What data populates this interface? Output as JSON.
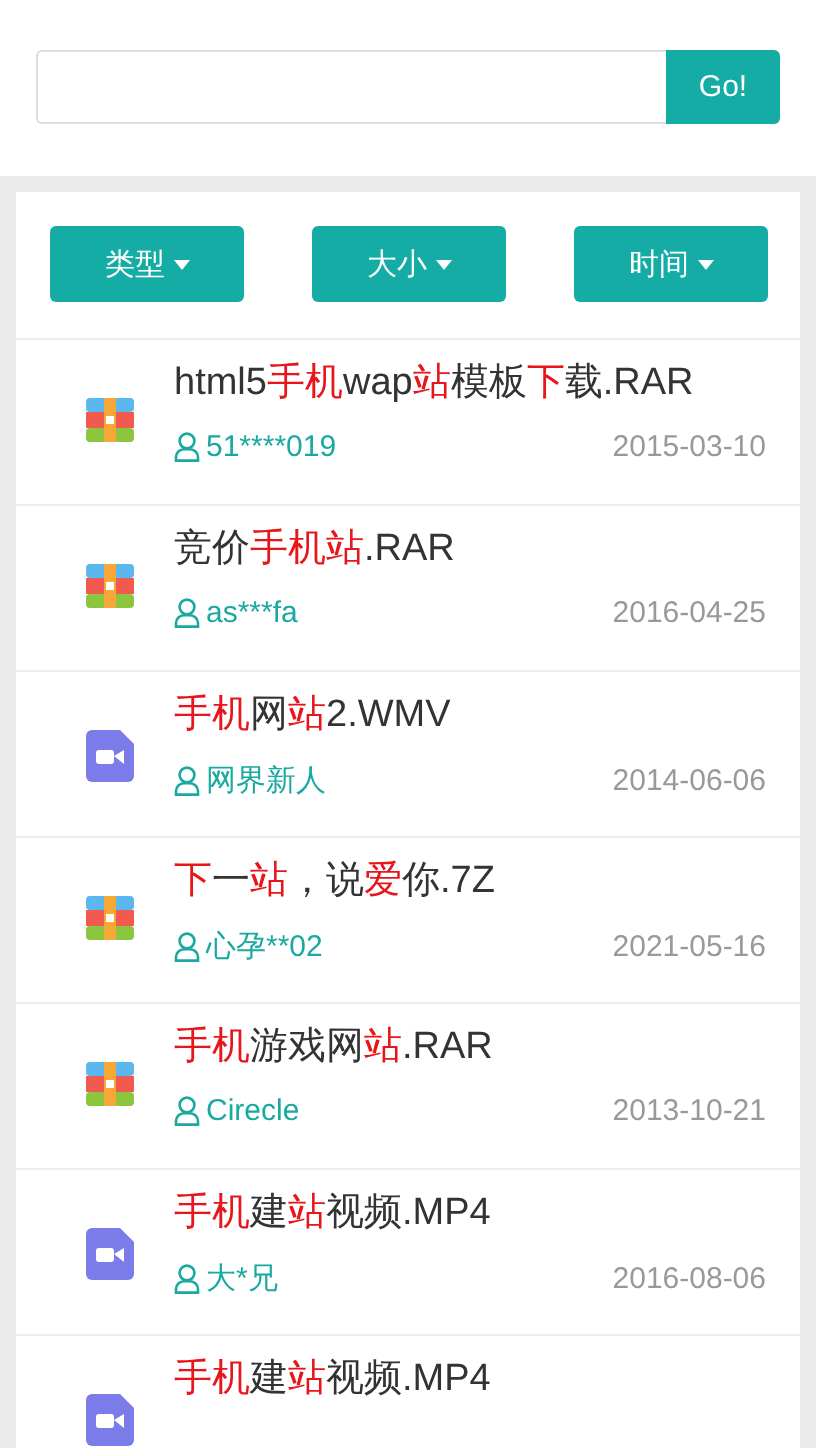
{
  "search": {
    "button": "Go!"
  },
  "filters": [
    {
      "label": "类型"
    },
    {
      "label": "大小"
    },
    {
      "label": "时间"
    }
  ],
  "files": [
    {
      "kind": "archive",
      "title": [
        {
          "text": "html5",
          "highlight": false
        },
        {
          "text": "手机",
          "highlight": true
        },
        {
          "text": "wap",
          "highlight": false
        },
        {
          "text": "站",
          "highlight": true
        },
        {
          "text": "模板",
          "highlight": false
        },
        {
          "text": "下",
          "highlight": true
        },
        {
          "text": "载.RAR",
          "highlight": false
        }
      ],
      "user": "51****019",
      "date": "2015-03-10"
    },
    {
      "kind": "archive",
      "title": [
        {
          "text": "竞价",
          "highlight": false
        },
        {
          "text": "手机站",
          "highlight": true
        },
        {
          "text": ".RAR",
          "highlight": false
        }
      ],
      "user": "as***fa",
      "date": "2016-04-25"
    },
    {
      "kind": "video",
      "title": [
        {
          "text": "手机",
          "highlight": true
        },
        {
          "text": "网",
          "highlight": false
        },
        {
          "text": "站",
          "highlight": true
        },
        {
          "text": "2.WMV",
          "highlight": false
        }
      ],
      "user": "网界新人",
      "date": "2014-06-06"
    },
    {
      "kind": "archive",
      "title": [
        {
          "text": "下",
          "highlight": true
        },
        {
          "text": "一",
          "highlight": false
        },
        {
          "text": "站",
          "highlight": true
        },
        {
          "text": "，说",
          "highlight": false
        },
        {
          "text": "爱",
          "highlight": true
        },
        {
          "text": "你.7Z",
          "highlight": false
        }
      ],
      "user": "心孕**02",
      "date": "2021-05-16"
    },
    {
      "kind": "archive",
      "title": [
        {
          "text": "手机",
          "highlight": true
        },
        {
          "text": "游戏网",
          "highlight": false
        },
        {
          "text": "站",
          "highlight": true
        },
        {
          "text": ".RAR",
          "highlight": false
        }
      ],
      "user": "Cirecle",
      "date": "2013-10-21"
    },
    {
      "kind": "video",
      "title": [
        {
          "text": "手机",
          "highlight": true
        },
        {
          "text": "建",
          "highlight": false
        },
        {
          "text": "站",
          "highlight": true
        },
        {
          "text": "视频.MP4",
          "highlight": false
        }
      ],
      "user": "大*兄",
      "date": "2016-08-06"
    },
    {
      "kind": "video",
      "title": [
        {
          "text": "手机",
          "highlight": true
        },
        {
          "text": "建",
          "highlight": false
        },
        {
          "text": "站",
          "highlight": true
        },
        {
          "text": "视频.MP4",
          "highlight": false
        }
      ]
    }
  ]
}
